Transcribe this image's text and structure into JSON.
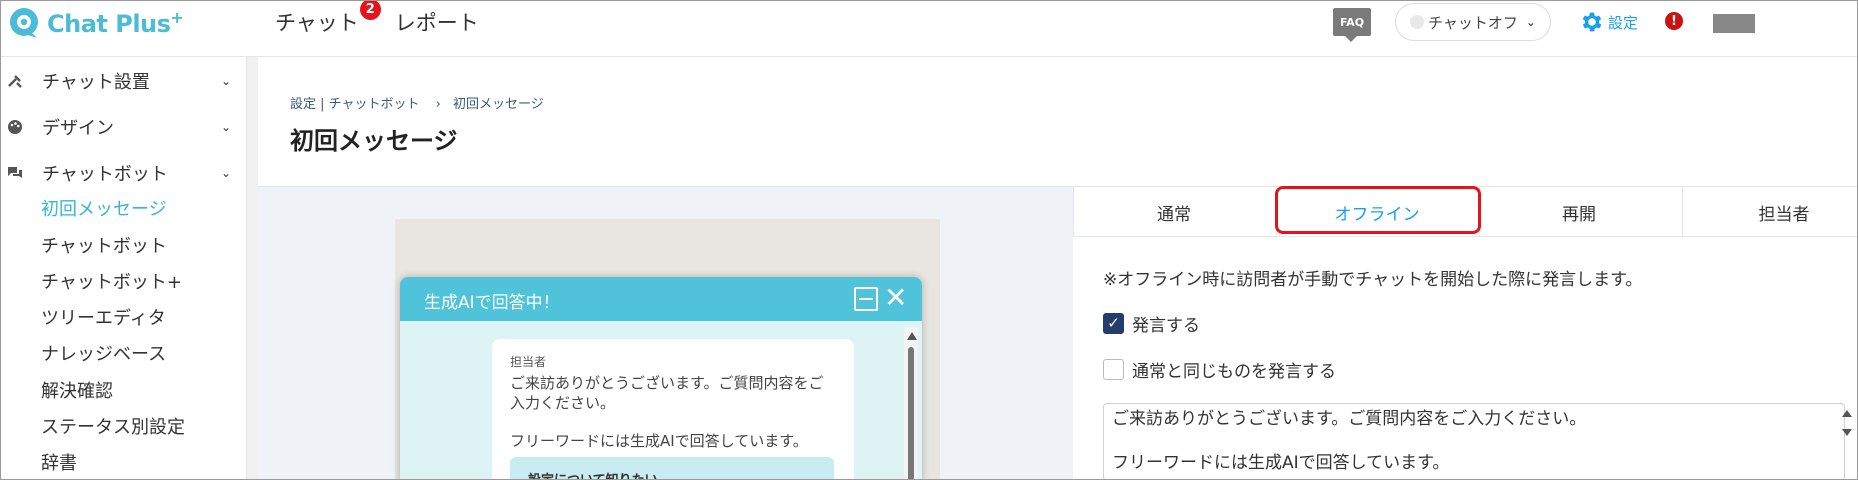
{
  "header": {
    "logo_text": "Chat Plus",
    "logo_plus": "+",
    "nav": [
      {
        "label": "チャット",
        "badge": "2"
      },
      {
        "label": "レポート"
      }
    ],
    "faq_label": "FAQ",
    "status_label": "チャットオフ",
    "settings_label": "設定",
    "alert_label": "!"
  },
  "sidebar": {
    "groups": [
      {
        "label": "チャット設置",
        "icon": "tools-icon"
      },
      {
        "label": "デザイン",
        "icon": "palette-icon"
      },
      {
        "label": "チャットボット",
        "icon": "chat-bubbles-icon"
      }
    ],
    "items": [
      {
        "label": "初回メッセージ",
        "active": true
      },
      {
        "label": "チャットボット"
      },
      {
        "label": "チャットボット+"
      },
      {
        "label": "ツリーエディタ"
      },
      {
        "label": "ナレッジベース"
      },
      {
        "label": "解決確認"
      },
      {
        "label": "ステータス別設定"
      },
      {
        "label": "辞書"
      }
    ]
  },
  "page": {
    "breadcrumb": [
      "設定 | チャットボット",
      "›",
      "初回メッセージ"
    ],
    "title": "初回メッセージ"
  },
  "preview": {
    "chat_title": "生成AIで回答中！",
    "sender": "担当者",
    "message_1": "ご来訪ありがとうございます。ご質問内容をご入力ください。",
    "message_2": "フリーワードには生成AIで回答しています。",
    "option_label": "設定について知りたい"
  },
  "panel": {
    "tabs": [
      {
        "label": "通常"
      },
      {
        "label": "オフライン",
        "active": true
      },
      {
        "label": "再開"
      },
      {
        "label": "担当者"
      }
    ],
    "note": "※オフライン時に訪問者が手動でチャットを開始した際に発言します。",
    "checkbox_speak": {
      "label": "発言する",
      "checked": true
    },
    "checkbox_same": {
      "label": "通常と同じものを発言する",
      "checked": false
    },
    "message_value": "ご来訪ありがとうございます。ご質問内容をご入力ください。",
    "message_value_2": "フリーワードには生成AIで回答しています。"
  },
  "colors": {
    "brand": "#4bbcd6",
    "accent": "#1aa0e8",
    "highlight": "#e5141c",
    "sidebar_active": "#35b6d8",
    "check": "#243d6b"
  }
}
